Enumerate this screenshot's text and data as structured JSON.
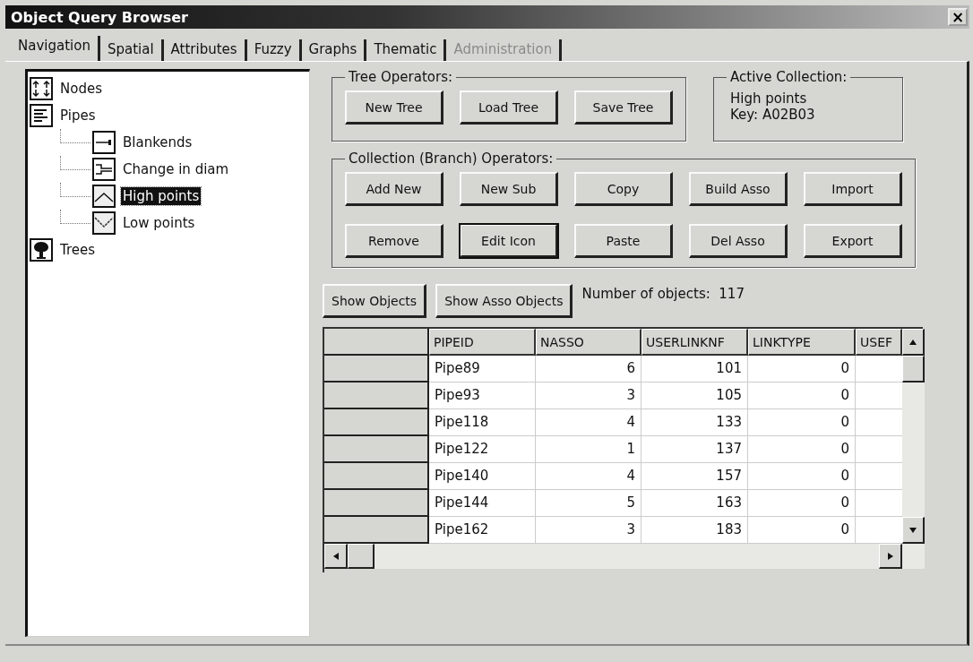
{
  "window": {
    "title": "Object Query Browser",
    "close": "×"
  },
  "tabs": [
    {
      "label": "Navigation",
      "selected": true,
      "disabled": false
    },
    {
      "label": "Spatial",
      "selected": false,
      "disabled": false
    },
    {
      "label": "Attributes",
      "selected": false,
      "disabled": false
    },
    {
      "label": "Fuzzy",
      "selected": false,
      "disabled": false
    },
    {
      "label": "Graphs",
      "selected": false,
      "disabled": false
    },
    {
      "label": "Thematic",
      "selected": false,
      "disabled": false
    },
    {
      "label": "Administration",
      "selected": false,
      "disabled": true
    }
  ],
  "tree": [
    {
      "label": "Nodes",
      "kind": "nodes",
      "selected": false
    },
    {
      "label": "Pipes",
      "kind": "pipes",
      "selected": false,
      "children": [
        {
          "label": "Blankends",
          "kind": "blankend",
          "selected": false
        },
        {
          "label": "Change in diam",
          "kind": "diam",
          "selected": false
        },
        {
          "label": "High points",
          "kind": "high",
          "selected": true
        },
        {
          "label": "Low points",
          "kind": "low",
          "selected": false
        }
      ]
    },
    {
      "label": "Trees",
      "kind": "trees",
      "selected": false
    }
  ],
  "tree_operators": {
    "title": "Tree Operators:",
    "buttons": [
      {
        "label": "New Tree",
        "default": false
      },
      {
        "label": "Load Tree",
        "default": false
      },
      {
        "label": "Save Tree",
        "default": false
      }
    ]
  },
  "active_collection": {
    "title": "Active Collection:",
    "lines": [
      "High points",
      "Key: A02B03"
    ]
  },
  "collection_operators": {
    "title": "Collection (Branch) Operators:",
    "buttons": [
      {
        "label": "Add New",
        "default": false
      },
      {
        "label": "New Sub",
        "default": false
      },
      {
        "label": "Copy",
        "default": false
      },
      {
        "label": "Build Asso",
        "default": false
      },
      {
        "label": "Import",
        "default": false
      },
      {
        "label": "Remove",
        "default": false
      },
      {
        "label": "Edit Icon",
        "default": true
      },
      {
        "label": "Paste",
        "default": false
      },
      {
        "label": "Del Asso",
        "default": false
      },
      {
        "label": "Export",
        "default": false
      }
    ]
  },
  "object_buttons": [
    {
      "label": "Show Objects"
    },
    {
      "label": "Show Asso Objects"
    }
  ],
  "object_count": {
    "label": "Number of objects:",
    "value": "117"
  },
  "table": {
    "columns": [
      "PIPEID",
      "NASSO",
      "USERLINKNF",
      "LINKTYPE",
      "USEF"
    ],
    "rows": [
      [
        "Pipe89",
        "6",
        "101",
        "0"
      ],
      [
        "Pipe93",
        "3",
        "105",
        "0"
      ],
      [
        "Pipe118",
        "4",
        "133",
        "0"
      ],
      [
        "Pipe122",
        "1",
        "137",
        "0"
      ],
      [
        "Pipe140",
        "4",
        "157",
        "0"
      ],
      [
        "Pipe144",
        "5",
        "163",
        "0"
      ],
      [
        "Pipe162",
        "3",
        "183",
        "0"
      ]
    ]
  }
}
